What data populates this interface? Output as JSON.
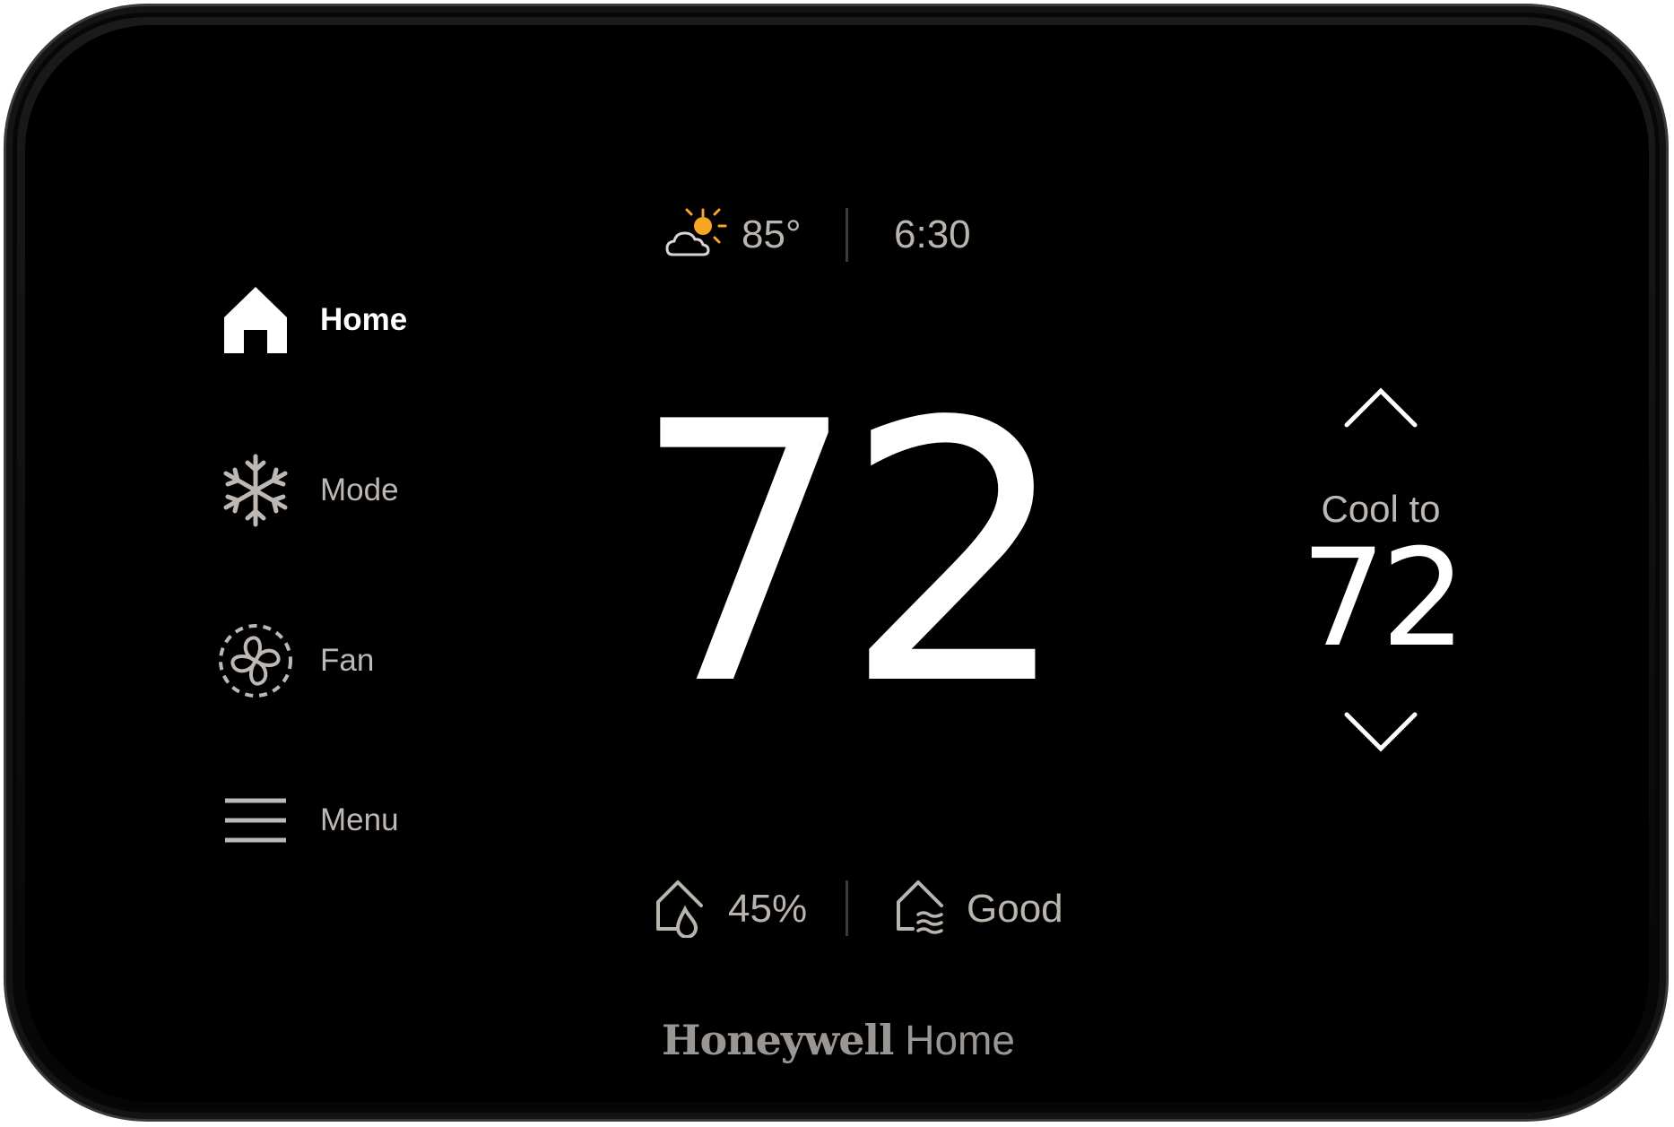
{
  "header": {
    "weather_icon": "partly-sunny-icon",
    "outdoor_temp": "85°",
    "time": "6:30"
  },
  "nav": {
    "items": [
      {
        "label": "Home",
        "icon": "home-icon",
        "active": true
      },
      {
        "label": "Mode",
        "icon": "snowflake-icon",
        "active": false
      },
      {
        "label": "Fan",
        "icon": "fan-icon",
        "active": false
      },
      {
        "label": "Menu",
        "icon": "menu-icon",
        "active": false
      }
    ]
  },
  "main": {
    "current_temp": "72"
  },
  "setpoint": {
    "label": "Cool to",
    "value": "72",
    "up_icon": "chevron-up-icon",
    "down_icon": "chevron-down-icon"
  },
  "footer": {
    "humidity_icon": "home-humidity-icon",
    "humidity": "45%",
    "air_quality_icon": "home-air-quality-icon",
    "air_quality": "Good"
  },
  "brand": {
    "name_bold": "Honeywell",
    "name_regular": "Home"
  },
  "colors": {
    "background": "#000000",
    "text_primary": "#ffffff",
    "text_secondary": "#bab4af",
    "sun_accent": "#f5a623"
  }
}
